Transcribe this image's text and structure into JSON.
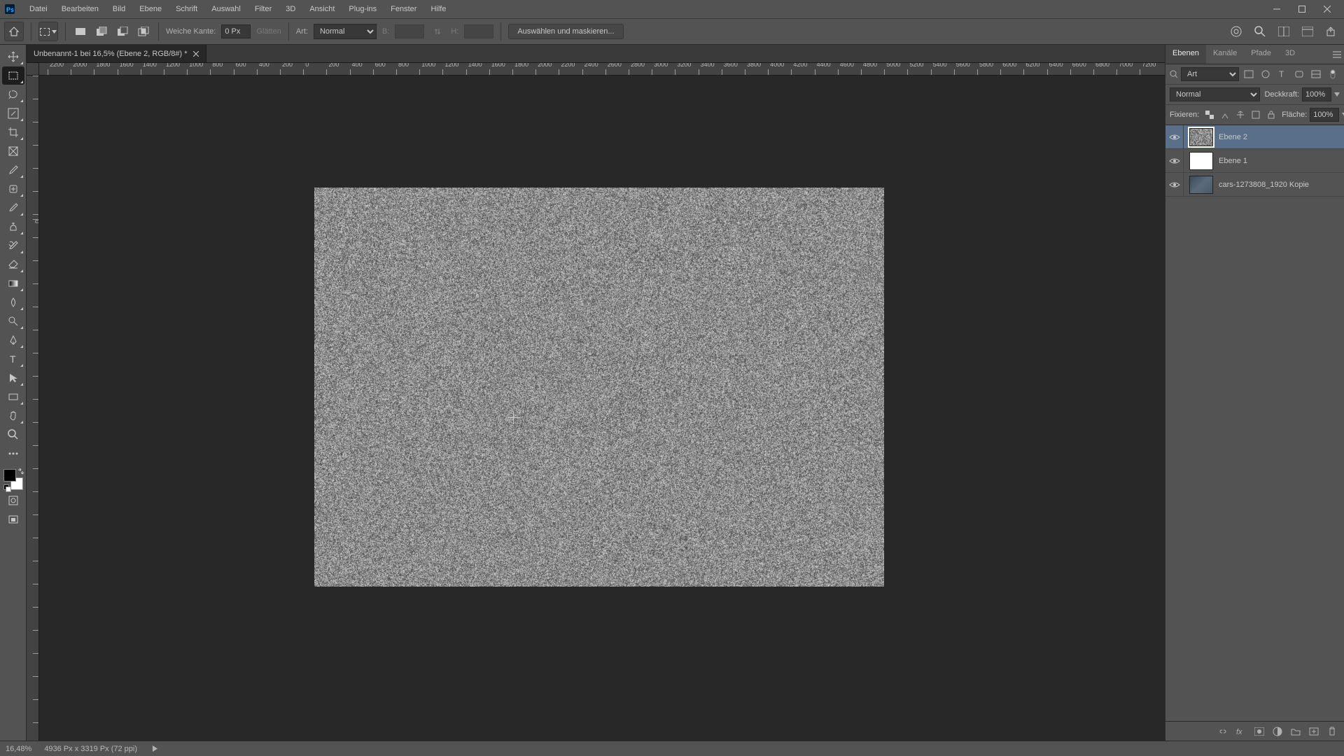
{
  "menu": {
    "items": [
      "Datei",
      "Bearbeiten",
      "Bild",
      "Ebene",
      "Schrift",
      "Auswahl",
      "Filter",
      "3D",
      "Ansicht",
      "Plug-ins",
      "Fenster",
      "Hilfe"
    ]
  },
  "options": {
    "feather_label": "Weiche Kante:",
    "feather_value": "0 Px",
    "antialias_label": "Glätten",
    "style_label": "Art:",
    "style_value": "Normal",
    "width_label": "B:",
    "width_value": "",
    "height_label": "H:",
    "height_value": "",
    "mask_button": "Auswählen und maskieren..."
  },
  "doc_tab": {
    "title": "Unbenannt-1 bei 16,5% (Ebene 2, RGB/8#) *"
  },
  "ruler": {
    "h_ticks": [
      "-2200",
      "-2000",
      "-1800",
      "-1600",
      "-1400",
      "-1200",
      "-1000",
      "-800",
      "-600",
      "-400",
      "-200",
      "0",
      "200",
      "400",
      "600",
      "800",
      "1000",
      "1200",
      "1400",
      "1600",
      "1800",
      "2000",
      "2200",
      "2400",
      "2600",
      "2800",
      "3000",
      "3200",
      "3400",
      "3600",
      "3800",
      "4000",
      "4200",
      "4400",
      "4600",
      "4800",
      "5000",
      "5200",
      "5400",
      "5600",
      "5800",
      "6000",
      "6200",
      "6400",
      "6600",
      "6800",
      "7000",
      "7200"
    ],
    "v_origin_label": "0"
  },
  "tools": [
    {
      "name": "move-tool",
      "sub": true
    },
    {
      "name": "rectangular-marquee-tool",
      "active": true,
      "sub": true
    },
    {
      "name": "lasso-tool",
      "sub": true
    },
    {
      "name": "magic-wand-tool",
      "sub": true
    },
    {
      "name": "crop-tool",
      "sub": true
    },
    {
      "name": "frame-tool",
      "sub": false
    },
    {
      "name": "eyedropper-tool",
      "sub": true
    },
    {
      "name": "healing-brush-tool",
      "sub": true
    },
    {
      "name": "brush-tool",
      "sub": true
    },
    {
      "name": "clone-stamp-tool",
      "sub": true
    },
    {
      "name": "history-brush-tool",
      "sub": true
    },
    {
      "name": "eraser-tool",
      "sub": true
    },
    {
      "name": "gradient-tool",
      "sub": true
    },
    {
      "name": "blur-tool",
      "sub": true
    },
    {
      "name": "dodge-tool",
      "sub": true
    },
    {
      "name": "pen-tool",
      "sub": true
    },
    {
      "name": "type-tool",
      "sub": true
    },
    {
      "name": "path-selection-tool",
      "sub": true
    },
    {
      "name": "rectangle-shape-tool",
      "sub": true
    },
    {
      "name": "hand-tool",
      "sub": true
    },
    {
      "name": "zoom-tool",
      "sub": false
    },
    {
      "name": "edit-toolbar",
      "sub": false
    }
  ],
  "extra_tools": [
    {
      "name": "quick-mask-toggle"
    },
    {
      "name": "screen-mode-toggle"
    }
  ],
  "panel": {
    "tabs": [
      "Ebenen",
      "Kanäle",
      "Pfade",
      "3D"
    ],
    "search_label": "Art",
    "blend_mode_value": "Normal",
    "opacity_label": "Deckkraft:",
    "opacity_value": "100%",
    "lock_label": "Fixieren:",
    "fill_label": "Fläche:",
    "fill_value": "100%",
    "layers": [
      {
        "name": "Ebene 2",
        "selected": true,
        "thumb": "noise"
      },
      {
        "name": "Ebene 1",
        "selected": false,
        "thumb": "plain"
      },
      {
        "name": "cars-1273808_1920 Kopie",
        "selected": false,
        "thumb": "img"
      }
    ]
  },
  "status": {
    "zoom": "16,48%",
    "info": "4936 Px x 3319 Px (72 ppi)"
  }
}
